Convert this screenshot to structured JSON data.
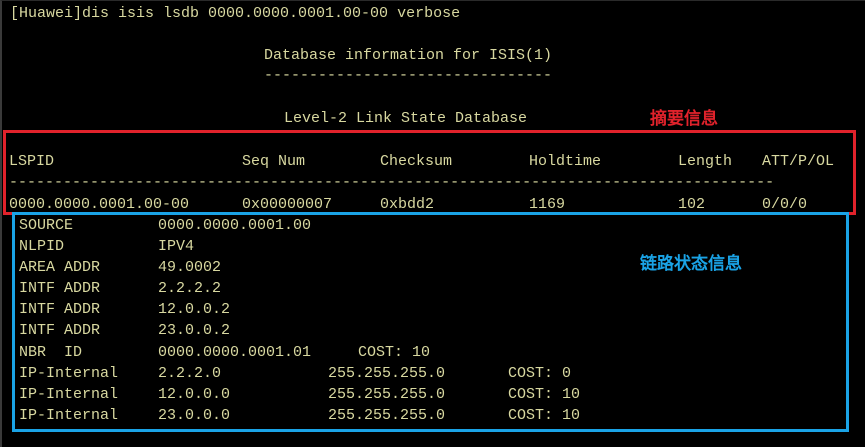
{
  "command": "[Huawei]dis isis lsdb 0000.0000.0001.00-00 verbose",
  "db_title": "Database information for ISIS(1)",
  "db_underline": "--------------------------------",
  "level_title": "Level-2 Link State Database",
  "annotations": {
    "summary": "摘要信息",
    "link_state": "链路状态信息",
    "summary_color": "#e0222b",
    "link_state_color": "#1aa3e6"
  },
  "table": {
    "headers": [
      "LSPID",
      "Seq Num",
      "Checksum",
      "Holdtime",
      "Length",
      "ATT/P/OL"
    ],
    "separator": "-------------------------------------------------------------------------------------",
    "row": [
      "0000.0000.0001.00-00",
      "0x00000007",
      "0xbdd2",
      "1169",
      "102",
      "0/0/0"
    ]
  },
  "details": [
    {
      "key": "SOURCE",
      "value": "0000.0000.0001.00"
    },
    {
      "key": "NLPID",
      "value": "IPV4"
    },
    {
      "key": "AREA ADDR",
      "value": "49.0002"
    },
    {
      "key": "INTF ADDR",
      "value": "2.2.2.2"
    },
    {
      "key": "INTF ADDR",
      "value": "12.0.0.2"
    },
    {
      "key": "INTF ADDR",
      "value": "23.0.0.2"
    },
    {
      "key": "NBR  ID",
      "value": "0000.0000.0001.01",
      "extra": "COST: 10"
    },
    {
      "key": "IP-Internal",
      "value": "2.2.2.0",
      "mask": "255.255.255.0",
      "extra": "COST: 0"
    },
    {
      "key": "IP-Internal",
      "value": "12.0.0.0",
      "mask": "255.255.255.0",
      "extra": "COST: 10"
    },
    {
      "key": "IP-Internal",
      "value": "23.0.0.0",
      "mask": "255.255.255.0",
      "extra": "COST: 10"
    }
  ]
}
